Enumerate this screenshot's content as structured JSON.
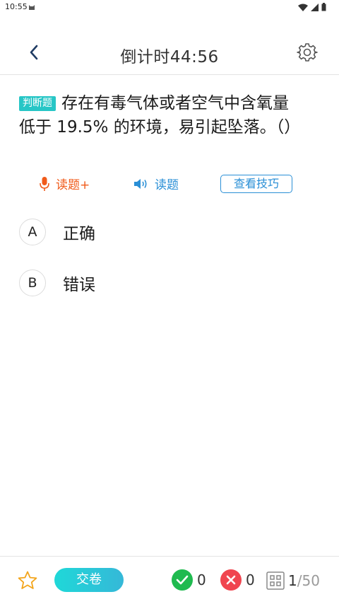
{
  "status_bar": {
    "time": "10:55"
  },
  "header": {
    "title": "倒计时44:56"
  },
  "question": {
    "tag": "判断题",
    "text": "存在有毒气体或者空气中含氧量低于 19.5% 的环境，易引起坠落。（）"
  },
  "tools": {
    "read_plus_label": "读题+",
    "read_label": "读题",
    "tips_label": "查看技巧"
  },
  "options": [
    {
      "letter": "A",
      "text": "正确"
    },
    {
      "letter": "B",
      "text": "错误"
    }
  ],
  "bottom": {
    "submit_label": "交卷",
    "correct_count": "0",
    "wrong_count": "0",
    "current_index": "1",
    "total": "/50"
  },
  "colors": {
    "accent_teal": "#27c6c6",
    "read_plus": "#f05a1a",
    "read": "#2a8fd6",
    "correct": "#1fba4f",
    "wrong": "#f0454f"
  }
}
